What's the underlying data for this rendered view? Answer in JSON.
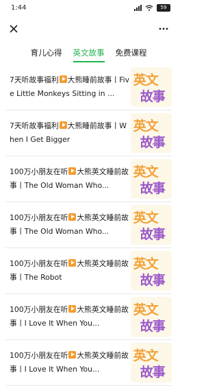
{
  "status": {
    "time": "1:44",
    "battery": "59"
  },
  "tabs": [
    "育儿心得",
    "英文故事",
    "免费课程"
  ],
  "active_tab": 1,
  "thumb": {
    "line1": "英文",
    "line2": "故事"
  },
  "articles": [
    {
      "pre": "7天听故事福利",
      "post": "大熊睡前故事丨Five Little Monkeys Sitting in ..."
    },
    {
      "pre": "7天听故事福利",
      "post": "大熊睡前故事丨When I Get Bigger"
    },
    {
      "pre": "100万小朋友在听",
      "post": "大熊英文睡前故事丨The Old Woman Who..."
    },
    {
      "pre": "100万小朋友在听",
      "post": "大熊英文睡前故事丨The Old Woman Who..."
    },
    {
      "pre": "100万小朋友在听",
      "post": "大熊英文睡前故事丨The Robot"
    },
    {
      "pre": "100万小朋友在听",
      "post": "大熊英文睡前故事丨I Love It When You..."
    },
    {
      "pre": "100万小朋友在听",
      "post": "大熊英文睡前故事丨I Love It When You..."
    }
  ]
}
